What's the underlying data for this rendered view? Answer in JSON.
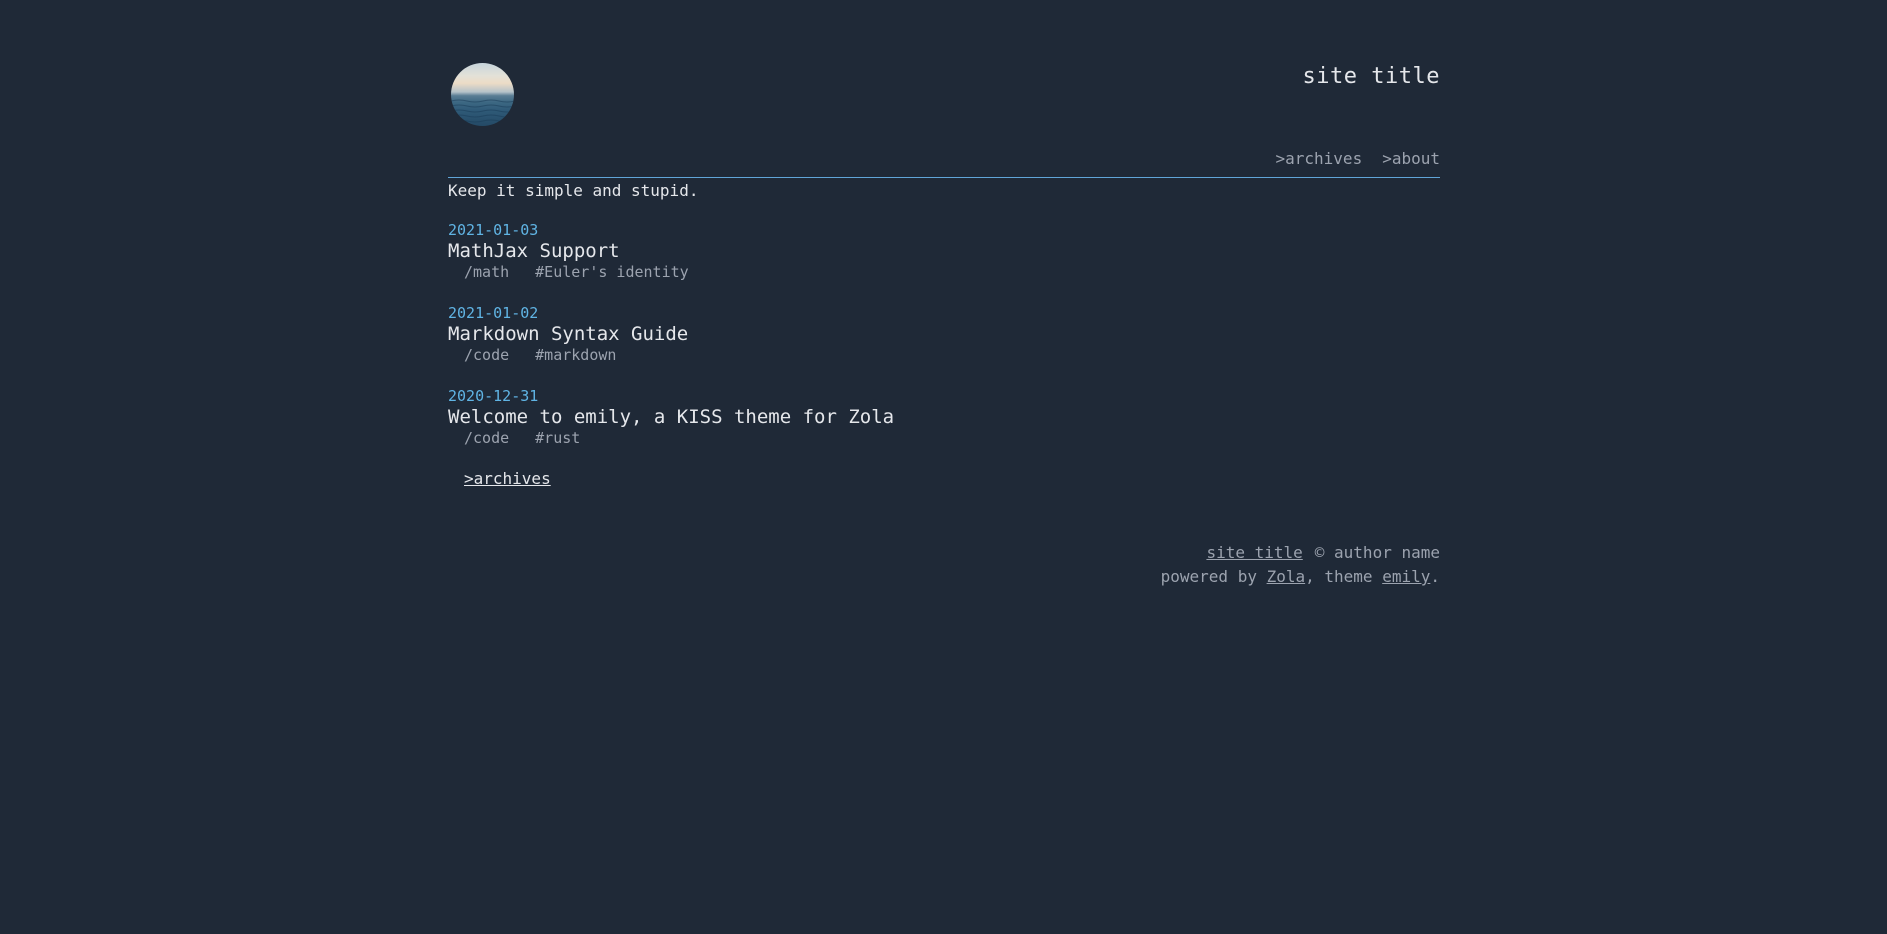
{
  "header": {
    "site_title": "site title",
    "avatar_icon": "ocean-horizon-avatar",
    "nav": [
      {
        "label": ">archives"
      },
      {
        "label": ">about"
      }
    ]
  },
  "tagline": "Keep it simple and stupid.",
  "posts": [
    {
      "date": "2021-01-03",
      "title": "MathJax Support",
      "category": "/math",
      "tag": "#Euler's identity"
    },
    {
      "date": "2021-01-02",
      "title": "Markdown Syntax Guide",
      "category": "/code",
      "tag": "#markdown"
    },
    {
      "date": "2020-12-31",
      "title": "Welcome to emily, a KISS theme for Zola",
      "category": "/code",
      "tag": "#rust"
    }
  ],
  "more_link": ">archives",
  "footer": {
    "site_title_link": "site title",
    "copyright": "© author name",
    "powered_by_prefix": "powered by ",
    "zola_link": "Zola",
    "theme_text": ", theme ",
    "emily_link": "emily",
    "period": "."
  },
  "colors": {
    "background": "#1f2937",
    "accent": "#60b4e4",
    "text": "#e5e7eb",
    "muted": "#9ca3af"
  }
}
